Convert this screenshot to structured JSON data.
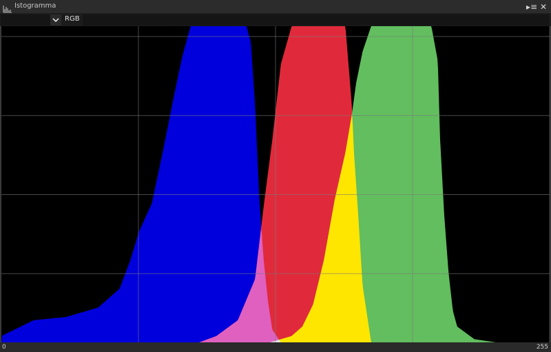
{
  "window": {
    "title": "Istogramma",
    "icon": "histogram-icon",
    "menu_icon": "menu-icon",
    "close_icon": "close-icon",
    "menu_glyph": "▸≡",
    "close_glyph": "✕"
  },
  "toolbar": {
    "channel": "RGB",
    "dropdown_icon": "chevron-down-icon"
  },
  "axis": {
    "x_min_label": "0",
    "x_max_label": "255"
  },
  "colors": {
    "blue": "#0000dc",
    "red": "#e02a3b",
    "green": "#62be5e",
    "magenta": "#e060c0",
    "yellow": "#ffe600",
    "cyan": "#00b4dc",
    "white": "#e6e6e6",
    "grid": "#7a7a7a",
    "background": "#000000"
  },
  "chart_data": {
    "type": "area",
    "title": "",
    "xlabel": "",
    "ylabel": "",
    "xlim": [
      0,
      255
    ],
    "grid": true,
    "overlay": [
      "blue+red=magenta",
      "red+green=yellow",
      "blue+green=cyan",
      "all=white"
    ],
    "series": [
      {
        "name": "B",
        "x": [
          0,
          15,
          30,
          45,
          55,
          60,
          64,
          70,
          75,
          80,
          84,
          88,
          90,
          92,
          95,
          100,
          105,
          110,
          114,
          116,
          118,
          120,
          122,
          124,
          126,
          130
        ],
        "y": [
          0.02,
          0.07,
          0.08,
          0.11,
          0.17,
          0.26,
          0.35,
          0.44,
          0.6,
          0.77,
          0.9,
          1.0,
          1.0,
          1.0,
          1.0,
          1.0,
          1.0,
          1.0,
          1.0,
          0.95,
          0.75,
          0.45,
          0.26,
          0.13,
          0.04,
          0.0
        ]
      },
      {
        "name": "R",
        "x": [
          92,
          100,
          110,
          118,
          122,
          126,
          128,
          130,
          135,
          140,
          145,
          150,
          155,
          160,
          163,
          164,
          166,
          168,
          172
        ],
        "y": [
          0.0,
          0.02,
          0.07,
          0.2,
          0.43,
          0.64,
          0.76,
          0.88,
          1.0,
          1.0,
          1.0,
          1.0,
          1.0,
          1.0,
          0.75,
          0.6,
          0.4,
          0.18,
          0.0
        ]
      },
      {
        "name": "G",
        "x": [
          125,
          135,
          140,
          145,
          150,
          155,
          160,
          163,
          165,
          168,
          172,
          175,
          178,
          180,
          185,
          195,
          200,
          203,
          204,
          206,
          208,
          210,
          212,
          220,
          230
        ],
        "y": [
          0.0,
          0.02,
          0.05,
          0.12,
          0.26,
          0.45,
          0.6,
          0.72,
          0.82,
          0.92,
          1.0,
          1.0,
          1.0,
          1.0,
          1.0,
          1.0,
          1.0,
          0.89,
          0.65,
          0.4,
          0.22,
          0.1,
          0.05,
          0.01,
          0.0
        ]
      }
    ]
  }
}
